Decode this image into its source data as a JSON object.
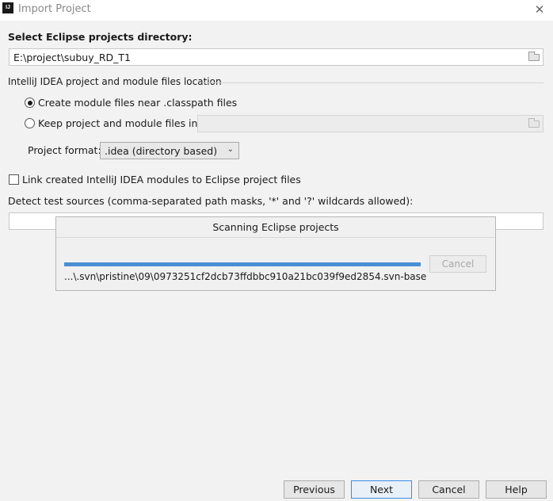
{
  "window": {
    "icon_text": "IJ",
    "title": "Import Project",
    "close_glyph": "✕"
  },
  "form": {
    "dir_label": "Select Eclipse projects directory:",
    "dir_value": "E:\\project\\subuy_RD_T1",
    "location_label": "IntelliJ IDEA project and module files location",
    "radio_near": {
      "label": "Create module files near .classpath files",
      "checked": true
    },
    "radio_keep": {
      "label": "Keep project and module files in",
      "checked": false
    },
    "keep_path_value": "",
    "format_label": "Project format:",
    "format_value": ".idea (directory based)",
    "link_checkbox_label": "Link created IntelliJ IDEA modules to Eclipse project files",
    "detect_label": "Detect test sources (comma-separated path masks, '*' and '?' wildcards allowed):",
    "detect_value": ""
  },
  "scan_dialog": {
    "title": "Scanning Eclipse projects",
    "progress_fraction": 1.0,
    "current_path": "...\\.svn\\pristine\\09\\0973251cf2dcb73ffdbbc910a21bc039f9ed2854.svn-base",
    "cancel_label": "Cancel"
  },
  "footer": {
    "previous": "Previous",
    "next": "Next",
    "cancel": "Cancel",
    "help": "Help"
  },
  "icons": {
    "folder": "folder-icon",
    "chevron": "chevron-down-icon",
    "close": "close-icon"
  },
  "colors": {
    "accent": "#3a8ee6",
    "progress": "#4a8fd4"
  }
}
